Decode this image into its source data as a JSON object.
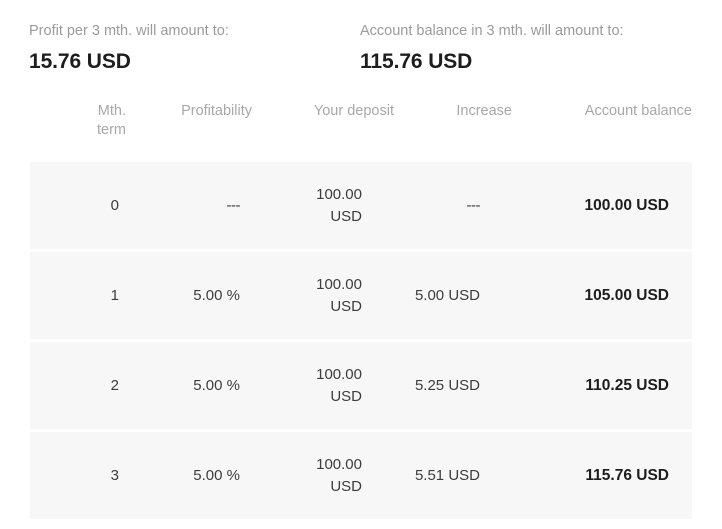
{
  "summary": {
    "profit": {
      "label": "Profit per 3 mth. will amount to:",
      "value": "15.76 USD"
    },
    "balance": {
      "label": "Account balance in 3 mth. will amount to:",
      "value": "115.76 USD"
    }
  },
  "table": {
    "headers": {
      "term_line1": "Mth.",
      "term_line2": "term",
      "profitability": "Profitability",
      "deposit": "Your deposit",
      "increase": "Increase",
      "balance": "Account balance"
    },
    "rows": [
      {
        "term": "0",
        "profitability": "---",
        "deposit": "100.00 USD",
        "increase": "---",
        "balance": "100.00 USD"
      },
      {
        "term": "1",
        "profitability": "5.00 %",
        "deposit": "100.00 USD",
        "increase": "5.00 USD",
        "balance": "105.00 USD"
      },
      {
        "term": "2",
        "profitability": "5.00 %",
        "deposit": "100.00 USD",
        "increase": "5.25 USD",
        "balance": "110.25 USD"
      },
      {
        "term": "3",
        "profitability": "5.00 %",
        "deposit": "100.00 USD",
        "increase": "5.51 USD",
        "balance": "115.76 USD"
      }
    ]
  },
  "colors": {
    "row_background": "#f7f7f7",
    "muted_text": "#a8a8a8",
    "primary_text": "#1d1d1d"
  }
}
